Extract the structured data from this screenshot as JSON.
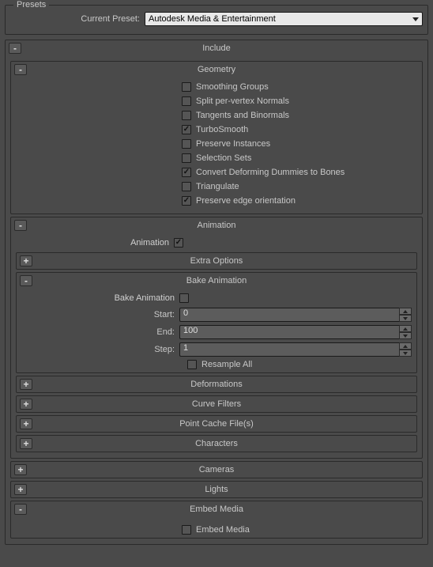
{
  "presets": {
    "fieldset_label": "Presets",
    "current_label": "Current Preset:",
    "current_value": "Autodesk Media & Entertainment"
  },
  "include": {
    "title": "Include",
    "toggle": "-",
    "geometry": {
      "title": "Geometry",
      "toggle": "-",
      "items": [
        {
          "label": "Smoothing Groups",
          "checked": false
        },
        {
          "label": "Split per-vertex Normals",
          "checked": false
        },
        {
          "label": "Tangents and Binormals",
          "checked": false
        },
        {
          "label": "TurboSmooth",
          "checked": true
        },
        {
          "label": "Preserve Instances",
          "checked": false
        },
        {
          "label": "Selection Sets",
          "checked": false
        },
        {
          "label": "Convert Deforming Dummies to Bones",
          "checked": true
        },
        {
          "label": "Triangulate",
          "checked": false
        },
        {
          "label": "Preserve edge orientation",
          "checked": true
        }
      ]
    },
    "animation": {
      "title": "Animation",
      "toggle": "-",
      "enable_label": "Animation",
      "enable_checked": true,
      "extra_options": {
        "title": "Extra Options",
        "toggle": "+"
      },
      "bake": {
        "title": "Bake Animation",
        "toggle": "-",
        "enable_label": "Bake Animation",
        "enable_checked": false,
        "start_label": "Start:",
        "start_value": "0",
        "end_label": "End:",
        "end_value": "100",
        "step_label": "Step:",
        "step_value": "1",
        "resample_label": "Resample All",
        "resample_checked": false
      },
      "deformations": {
        "title": "Deformations",
        "toggle": "+"
      },
      "curve_filters": {
        "title": "Curve Filters",
        "toggle": "+"
      },
      "point_cache": {
        "title": "Point Cache File(s)",
        "toggle": "+"
      },
      "characters": {
        "title": "Characters",
        "toggle": "+"
      }
    },
    "cameras": {
      "title": "Cameras",
      "toggle": "+"
    },
    "lights": {
      "title": "Lights",
      "toggle": "+"
    },
    "embed_media": {
      "title": "Embed Media",
      "toggle": "-",
      "enable_label": "Embed Media",
      "enable_checked": false
    }
  }
}
